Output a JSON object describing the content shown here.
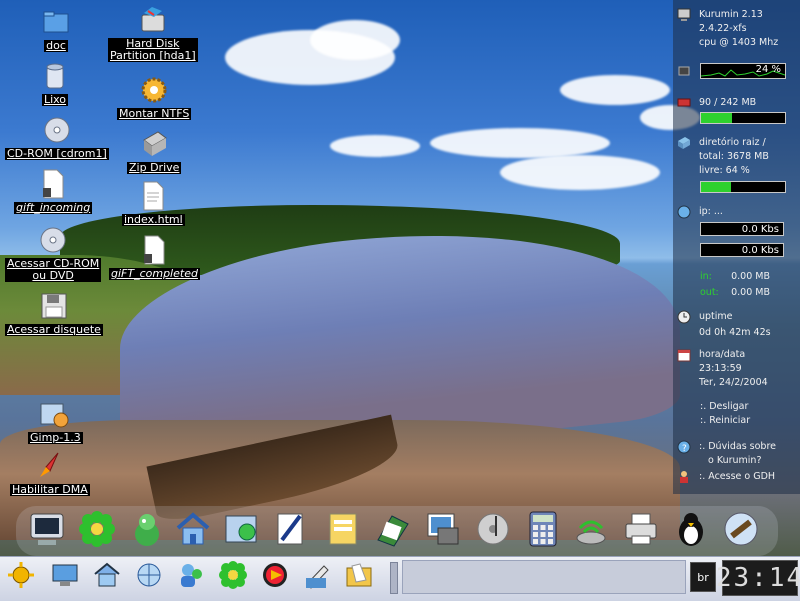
{
  "desktop": {
    "icons": [
      {
        "label": "doc",
        "icon": "folder-icon"
      },
      {
        "label": "Lixo",
        "icon": "trash-icon"
      },
      {
        "label": "CD-ROM [cdrom1]",
        "icon": "cdrom-icon"
      },
      {
        "label": "gift_incoming",
        "icon": "file-icon"
      },
      {
        "label": "Acessar CD-ROM\nou DVD",
        "icon": "cdrom-icon"
      },
      {
        "label": "Acessar disquete",
        "icon": "floppy-icon"
      },
      {
        "label": "Gimp-1.3",
        "icon": "gimp-icon"
      },
      {
        "label": "Habilitar DMA",
        "icon": "rocket-icon"
      },
      {
        "label": "Hard Disk\nPartition [hda1]",
        "icon": "hard-disk-icon"
      },
      {
        "label": "Montar NTFS",
        "icon": "gear-icon"
      },
      {
        "label": "Zip Drive",
        "icon": "zip-drive-icon"
      },
      {
        "label": "index.html",
        "icon": "html-file-icon"
      },
      {
        "label": "giFT_completed",
        "icon": "file-icon"
      }
    ]
  },
  "system_monitor": {
    "os": "Kurumin 2.13",
    "kernel": "2.4.22-xfs",
    "cpu": "cpu @ 1403 Mhz",
    "cpu_percent_label": "24 %",
    "memory": "90 / 242 MB",
    "memory_fraction": 0.37,
    "disk_title": "diretório raiz /",
    "disk_total": "total: 3678 MB",
    "disk_free": "livre: 64 %",
    "disk_used_fraction": 0.36,
    "ip": "ip: ...",
    "net_in_rate": "0.0 Kbs",
    "net_out_rate": "0.0 Kbs",
    "in_label": "in:",
    "in_total": "0.00 MB",
    "out_label": "out:",
    "out_total": "0.00 MB",
    "uptime_label": "uptime",
    "uptime_value": "0d 0h 42m 42s",
    "datetime_label": "hora/data",
    "time": "23:13:59",
    "date": "Ter, 24/2/2004",
    "shutdown": ":. Desligar",
    "restart": ":. Reiniciar",
    "help_line1": ":. Dúvidas sobre",
    "help_line2": "o Kurumin?",
    "gdh": ":. Acesse o GDH"
  },
  "dock": {
    "items": [
      "terminal-icon",
      "icq-flower-icon",
      "mascot-icon",
      "home-icon",
      "control-panel-icon",
      "text-editor-icon",
      "calculator-notes-icon",
      "office-icon",
      "photos-icon",
      "music-icon",
      "calculator-icon",
      "network-icon",
      "printer-icon",
      "tux-icon",
      "video-icon"
    ]
  },
  "taskbar": {
    "buttons": [
      "kde-menu-icon",
      "desktop-icon",
      "home-icon",
      "web-browser-icon",
      "user-icon",
      "icq-flower-icon",
      "media-player-icon",
      "paint-icon",
      "folder-icon"
    ],
    "keyboard_layout": "br",
    "clock": "23:14"
  },
  "colors": {
    "monitor_bar": "#2ed12e",
    "taskbar_bg": "#cdd3e3"
  }
}
